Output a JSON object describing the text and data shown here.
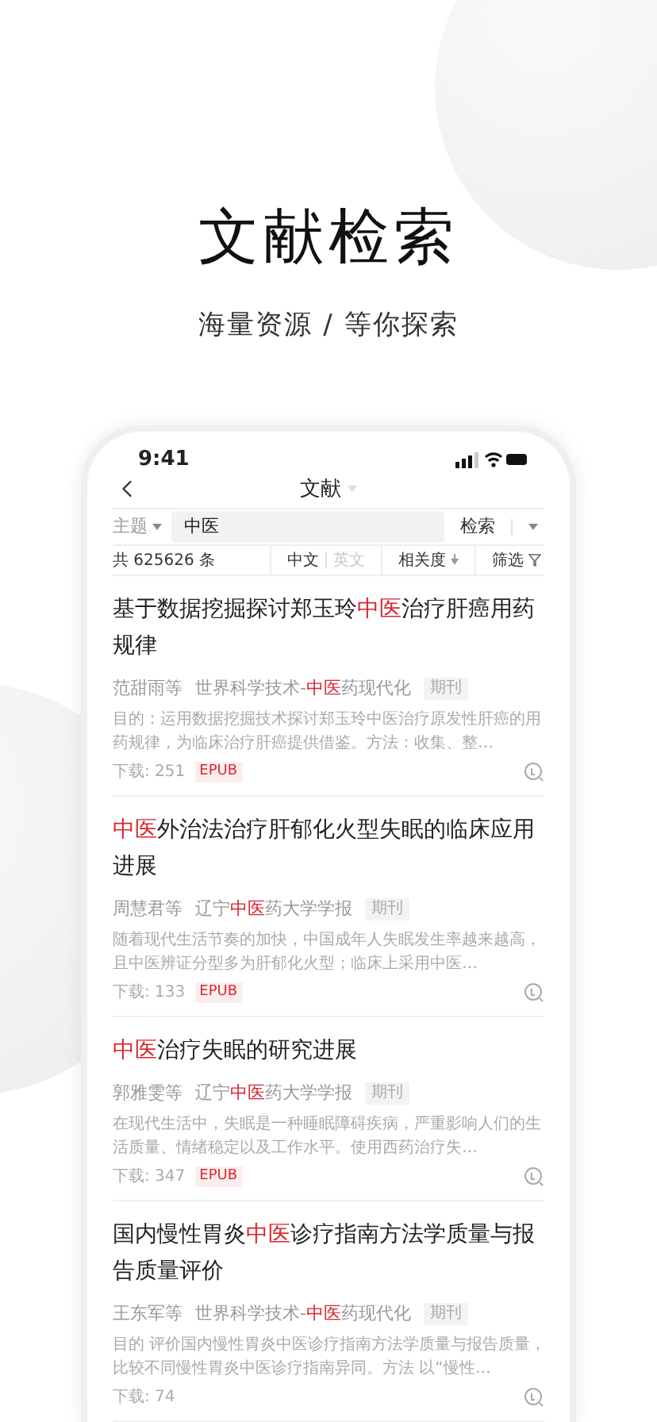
{
  "hero": {
    "title": "文献检索",
    "subtitle": "海量资源 / 等你探索"
  },
  "status_bar": {
    "time": "9:41"
  },
  "nav": {
    "title": "文献"
  },
  "search": {
    "field": "主题",
    "value": "中医",
    "button": "检索"
  },
  "result_bar": {
    "count": "共 625626 条",
    "languages": [
      {
        "label": "中文",
        "selected": true
      },
      {
        "label": "英文",
        "selected": false
      }
    ],
    "sort": "相关度",
    "filter": "筛选"
  },
  "results": [
    {
      "title": [
        {
          "text": "基于数据挖掘探讨郑玉玲",
          "highlight": false
        },
        {
          "text": "中医",
          "highlight": true
        },
        {
          "text": "治疗肝癌用药规律",
          "highlight": false
        }
      ],
      "authors": "范甜雨等",
      "source": [
        {
          "text": "世界科学技术-",
          "highlight": false
        },
        {
          "text": "中医",
          "highlight": true
        },
        {
          "text": "药现代化",
          "highlight": false
        }
      ],
      "type": "期刊",
      "abstract": "目的：运用数据挖掘技术探讨郑玉玲中医治疗原发性肝癌的用药规律，为临床治疗肝癌提供借鉴。方法：收集、整…",
      "downloads": "下载: 251",
      "format": "EPUB"
    },
    {
      "title": [
        {
          "text": "中医",
          "highlight": true
        },
        {
          "text": "外治法治疗肝郁化火型失眠的临床应用进展",
          "highlight": false
        }
      ],
      "authors": "周慧君等",
      "source": [
        {
          "text": "辽宁",
          "highlight": false
        },
        {
          "text": "中医",
          "highlight": true
        },
        {
          "text": "药大学学报",
          "highlight": false
        }
      ],
      "type": "期刊",
      "abstract": "随着现代生活节奏的加快，中国成年人失眠发生率越来越高，且中医辨证分型多为肝郁化火型；临床上采用中医…",
      "downloads": "下载: 133",
      "format": "EPUB"
    },
    {
      "title": [
        {
          "text": "中医",
          "highlight": true
        },
        {
          "text": "治疗失眠的研究进展",
          "highlight": false
        }
      ],
      "authors": "郭雅雯等",
      "source": [
        {
          "text": "辽宁",
          "highlight": false
        },
        {
          "text": "中医",
          "highlight": true
        },
        {
          "text": "药大学学报",
          "highlight": false
        }
      ],
      "type": "期刊",
      "abstract": "在现代生活中，失眠是一种睡眠障碍疾病，严重影响人们的生活质量、情绪稳定以及工作水平。使用西药治疗失…",
      "downloads": "下载: 347",
      "format": "EPUB"
    },
    {
      "title": [
        {
          "text": "国内慢性胃炎",
          "highlight": false
        },
        {
          "text": "中医",
          "highlight": true
        },
        {
          "text": "诊疗指南方法学质量与报告质量评价",
          "highlight": false
        }
      ],
      "authors": "王东军等",
      "source": [
        {
          "text": "世界科学技术-",
          "highlight": false
        },
        {
          "text": "中医",
          "highlight": true
        },
        {
          "text": "药现代化",
          "highlight": false
        }
      ],
      "type": "期刊",
      "abstract": "目的 评价国内慢性胃炎中医诊疗指南方法学质量与报告质量，比较不同慢性胃炎中医诊疗指南异同。方法 以“慢性…",
      "downloads": "下载: 74"
    }
  ]
}
